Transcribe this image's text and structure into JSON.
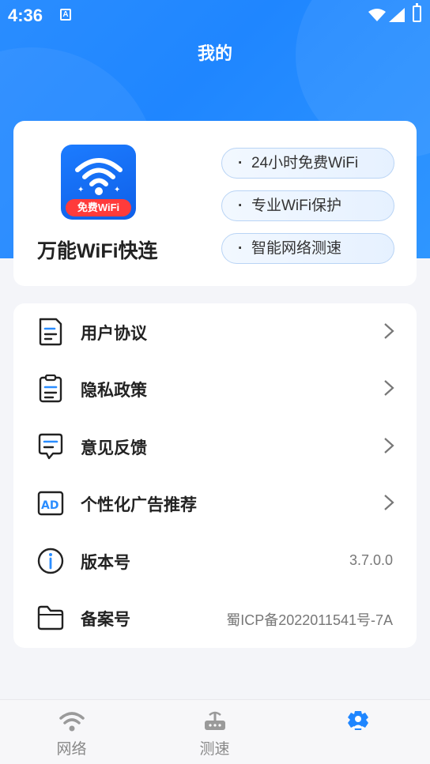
{
  "status_bar": {
    "time": "4:36",
    "notification_glyph": "A"
  },
  "header": {
    "title": "我的"
  },
  "app_card": {
    "logo_badge": "免费WiFi",
    "app_name": "万能WiFi快连",
    "features": [
      "24小时免费WiFi",
      "专业WiFi保护",
      "智能网络测速"
    ]
  },
  "menu": {
    "items": [
      {
        "label": "用户协议",
        "icon": "document-icon",
        "chevron": true
      },
      {
        "label": "隐私政策",
        "icon": "clipboard-icon",
        "chevron": true
      },
      {
        "label": "意见反馈",
        "icon": "feedback-message-icon",
        "chevron": true
      },
      {
        "label": "个性化广告推荐",
        "icon": "ad-icon",
        "chevron": true
      },
      {
        "label": "版本号",
        "icon": "info-icon",
        "value": "3.7.0.0"
      },
      {
        "label": "备案号",
        "icon": "folder-icon",
        "value": "蜀ICP备2022011541号-7A"
      }
    ]
  },
  "tabbar": {
    "tabs": [
      {
        "label": "网络",
        "icon": "wifi-icon",
        "active": false
      },
      {
        "label": "测速",
        "icon": "router-icon",
        "active": false
      },
      {
        "label": "",
        "icon": "gear-person-icon",
        "active": true
      }
    ]
  },
  "colors": {
    "brand_blue": "#1f86ff",
    "active_tab": "#1f86ff",
    "badge_red": "#ff3b3b"
  }
}
